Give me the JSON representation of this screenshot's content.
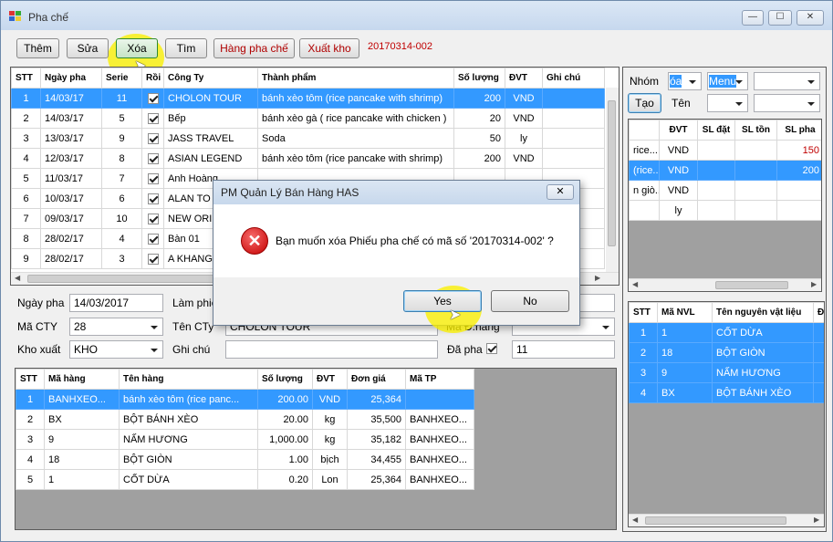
{
  "window": {
    "title": "Pha chế",
    "min": "—",
    "max": "☐",
    "close": "✕"
  },
  "toolbar": {
    "buttons": [
      "Thêm",
      "Sửa",
      "Xóa",
      "Tìm",
      "Hàng pha chế",
      "Xuất kho"
    ],
    "code": "20170314-002"
  },
  "main_grid": {
    "headers": [
      "STT",
      "Ngày pha",
      "Serie",
      "Rồi",
      "Công Ty",
      "Thành phẩm",
      "Số lượng",
      "ĐVT",
      "Ghi chú"
    ],
    "rows": [
      [
        "1",
        "14/03/17",
        "11",
        "",
        "CHOLON TOUR",
        "bánh xèo tôm (rice pancake with shrimp)",
        "200",
        "VND",
        ""
      ],
      [
        "2",
        "14/03/17",
        "5",
        "",
        "Bếp",
        "bánh xèo gà ( rice pancake with chicken )",
        "20",
        "VND",
        ""
      ],
      [
        "3",
        "13/03/17",
        "9",
        "",
        "JASS TRAVEL",
        "Soda",
        "50",
        "ly",
        ""
      ],
      [
        "4",
        "12/03/17",
        "8",
        "",
        "ASIAN LEGEND",
        "bánh xèo tôm (rice pancake with shrimp)",
        "200",
        "VND",
        ""
      ],
      [
        "5",
        "11/03/17",
        "7",
        "",
        "Anh Hoàng",
        "",
        "",
        "",
        ""
      ],
      [
        "6",
        "10/03/17",
        "6",
        "",
        "ALAN TO",
        "",
        "",
        "",
        ""
      ],
      [
        "7",
        "09/03/17",
        "10",
        "",
        "NEW ORIE",
        "",
        "",
        "",
        "m"
      ],
      [
        "8",
        "28/02/17",
        "4",
        "",
        "Bàn 01",
        "",
        "",
        "",
        ""
      ],
      [
        "9",
        "28/02/17",
        "3",
        "",
        "A KHANG",
        "",
        "",
        "",
        ""
      ]
    ]
  },
  "form": {
    "ngay_pha_label": "Ngày pha",
    "ngay_pha": "14/03/2017",
    "lam_phieu_label": "Làm phiếu",
    "ma_cty_label": "Mã CTY",
    "ma_cty": "28",
    "ten_cty_label": "Tên CTy",
    "ten_cty": "CHOLON TOUR",
    "ma_dhang_label": "Mã Đ.hàng",
    "kho_xuat_label": "Kho xuất",
    "kho_xuat": "KHO",
    "ghi_chu_label": "Ghi chú",
    "da_pha_label": "Đã pha",
    "da_pha_value": "11"
  },
  "detail_grid": {
    "headers": [
      "STT",
      "Mã hàng",
      "Tên hàng",
      "Số lượng",
      "ĐVT",
      "Đơn giá",
      "Mã TP"
    ],
    "rows": [
      [
        "1",
        "BANHXEO...",
        "bánh xèo tôm (rice panc...",
        "200.00",
        "VND",
        "25,364",
        ""
      ],
      [
        "2",
        "BX",
        "BỘT BÁNH XÈO",
        "20.00",
        "kg",
        "35,500",
        "BANHXEO..."
      ],
      [
        "3",
        "9",
        "NẤM HƯƠNG",
        "1,000.00",
        "kg",
        "35,182",
        "BANHXEO..."
      ],
      [
        "4",
        "18",
        "BỘT GIÒN",
        "1.00",
        "bịch",
        "34,455",
        "BANHXEO..."
      ],
      [
        "5",
        "1",
        "CỐT DỪA",
        "0.20",
        "Lon",
        "25,364",
        "BANHXEO..."
      ]
    ]
  },
  "right_filter": {
    "nhom_label": "Nhóm",
    "nhom1": "óa",
    "nhom2": "Menu",
    "tao": "Tạo",
    "ten_label": "Tên"
  },
  "right_grid": {
    "headers": [
      "",
      "ĐVT",
      "SL đặt",
      "SL tồn",
      "SL pha"
    ],
    "rows": [
      [
        "rice...",
        "VND",
        "",
        "",
        "150"
      ],
      [
        "(rice...",
        "VND",
        "",
        "",
        "200"
      ],
      [
        "n giò...",
        "VND",
        "",
        "",
        ""
      ],
      [
        "",
        "ly",
        "",
        "",
        ""
      ]
    ]
  },
  "nvl_grid": {
    "headers": [
      "STT",
      "Mã NVL",
      "Tên nguyên vật liệu",
      "Đ"
    ],
    "rows": [
      [
        "1",
        "1",
        "CỐT DỪA",
        ""
      ],
      [
        "2",
        "18",
        "BỘT GIÒN",
        ""
      ],
      [
        "3",
        "9",
        "NẤM HƯƠNG",
        ""
      ],
      [
        "4",
        "BX",
        "BỘT BÁNH XÈO",
        ""
      ]
    ]
  },
  "dialog": {
    "title": "PM Quản Lý Bán Hàng HAS",
    "close": "✕",
    "message": "Bạn muốn xóa Phiếu pha chế có mã số '20170314-002' ?",
    "yes": "Yes",
    "no": "No"
  },
  "colors": {
    "selection": "#3399ff",
    "accent_red": "#c00000"
  }
}
